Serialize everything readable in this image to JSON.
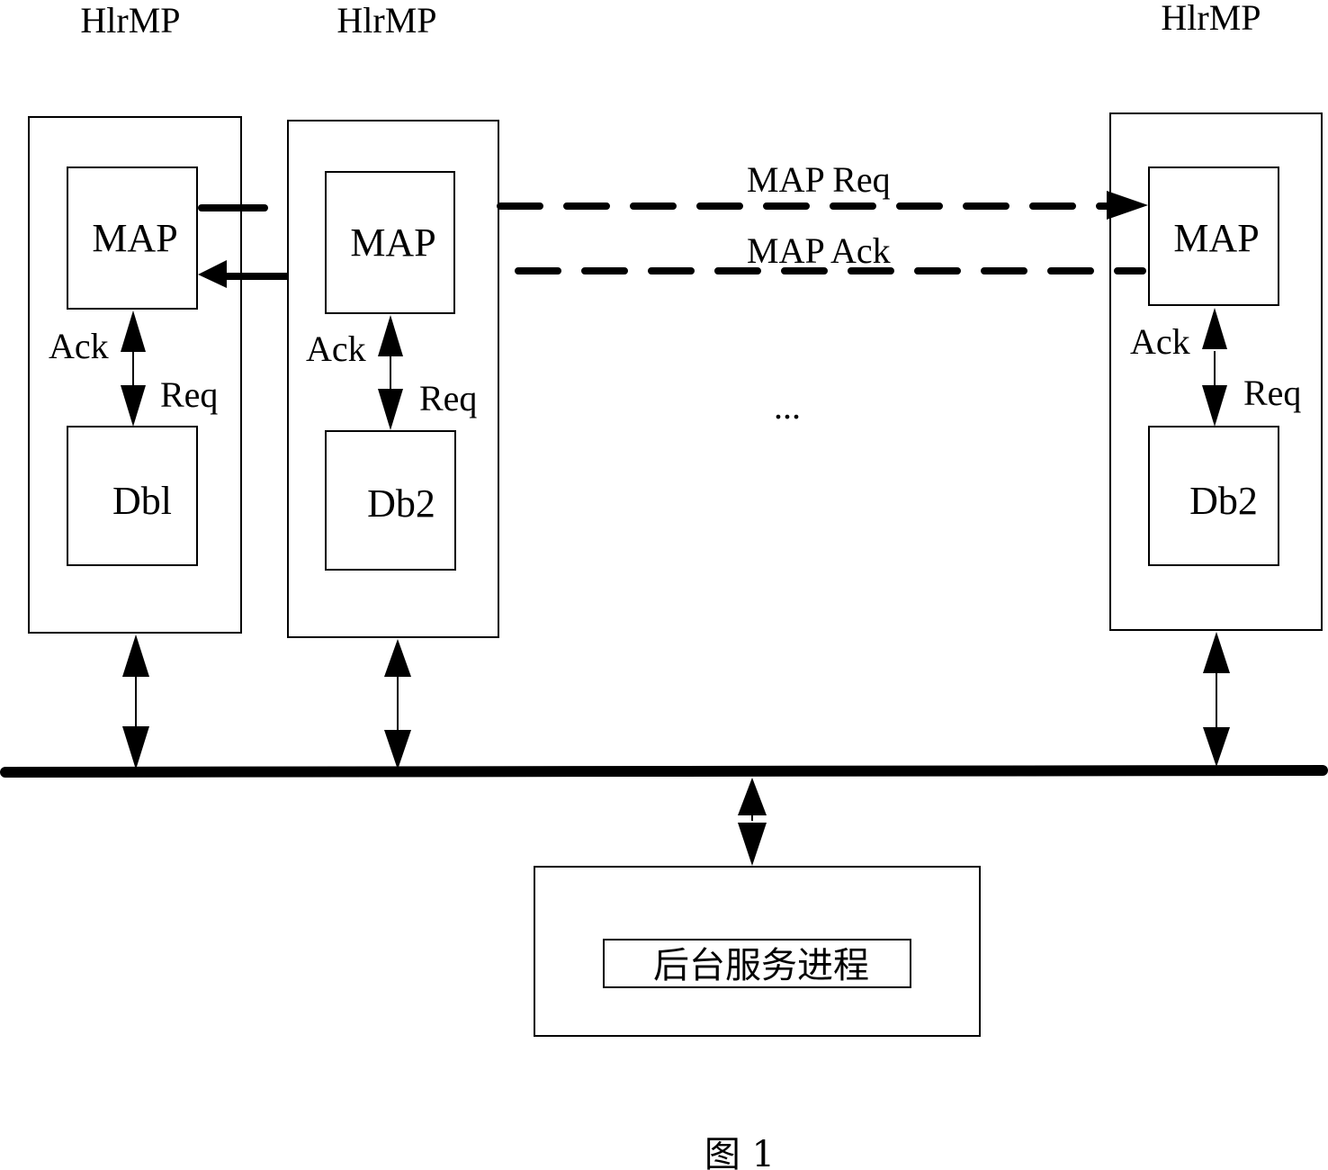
{
  "diagram": {
    "nodes": [
      {
        "id": "hlrmp1",
        "title": "HlrMP",
        "map_label": "MAP",
        "db_label": "Dbl",
        "ack_label": "Ack",
        "req_label": "Req"
      },
      {
        "id": "hlrmp2",
        "title": "HlrMP",
        "map_label": "MAP",
        "db_label": "Db2",
        "ack_label": "Ack",
        "req_label": "Req"
      },
      {
        "id": "hlrmp3",
        "title": "HlrMP",
        "map_label": "MAP",
        "db_label": "Db2",
        "ack_label": "Ack",
        "req_label": "Req"
      }
    ],
    "messages": {
      "map_req": "MAP Req",
      "map_ack": "MAP Ack"
    },
    "ellipsis": "...",
    "backend": {
      "label": "后台服务进程"
    },
    "caption": "图 1",
    "colors": {
      "stroke": "#000000",
      "background": "#ffffff"
    }
  }
}
